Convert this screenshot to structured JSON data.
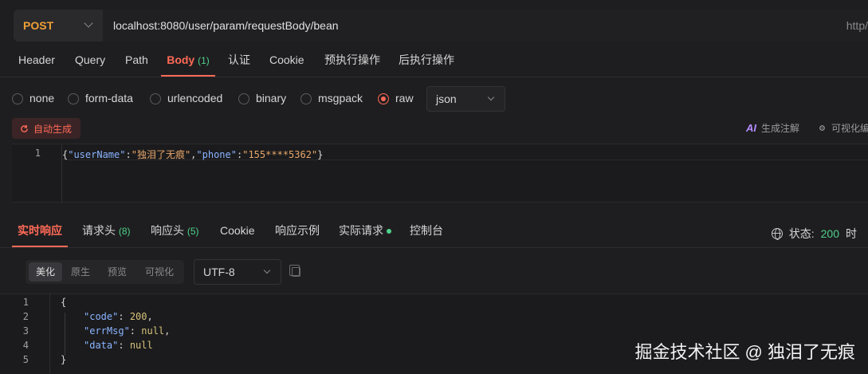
{
  "request": {
    "method": "POST",
    "url": "localhost:8080/user/param/requestBody/bean",
    "url_right": "http/"
  },
  "request_tabs": [
    {
      "label": "Header"
    },
    {
      "label": "Query"
    },
    {
      "label": "Path"
    },
    {
      "label": "Body",
      "count": "(1)",
      "active": true
    },
    {
      "label": "认证"
    },
    {
      "label": "Cookie"
    },
    {
      "label": "预执行操作"
    },
    {
      "label": "后执行操作"
    }
  ],
  "body_types": [
    {
      "label": "none"
    },
    {
      "label": "form-data"
    },
    {
      "label": "urlencoded"
    },
    {
      "label": "binary"
    },
    {
      "label": "msgpack"
    },
    {
      "label": "raw",
      "selected": true
    }
  ],
  "raw_format": "json",
  "tools": {
    "auto_generate": "自动生成",
    "ai_mark": "AI",
    "generate_comment": "生成注解",
    "visual_edit": "可视化编"
  },
  "request_body": {
    "line_number": "1",
    "key1": "\"userName\"",
    "val1": "\"独泪了无痕\"",
    "key2": "\"phone\"",
    "val2": "\"155****5362\""
  },
  "response_tabs": [
    {
      "label": "实时响应",
      "active": true
    },
    {
      "label": "请求头",
      "count": "(8)"
    },
    {
      "label": "响应头",
      "count": "(5)"
    },
    {
      "label": "Cookie"
    },
    {
      "label": "响应示例"
    },
    {
      "label": "实际请求",
      "dot": true
    },
    {
      "label": "控制台"
    }
  ],
  "status": {
    "label": "状态:",
    "value": "200",
    "extra": "时"
  },
  "view_modes": [
    {
      "label": "美化",
      "active": true
    },
    {
      "label": "原生"
    },
    {
      "label": "预览"
    },
    {
      "label": "可视化"
    }
  ],
  "encoding": "UTF-8",
  "response_body": {
    "line_numbers": [
      "1",
      "2",
      "3",
      "4",
      "5"
    ],
    "open": "{",
    "close": "}",
    "code_key": "\"code\"",
    "code_val": "200",
    "errmsg_key": "\"errMsg\"",
    "errmsg_val": "null",
    "data_key": "\"data\"",
    "data_val": "null"
  },
  "watermark": "掘金技术社区 @ 独泪了无痕",
  "colors": {
    "accent": "#ff6a57",
    "method": "#f0a034",
    "success": "#4fd18b",
    "background": "#1e1e20"
  }
}
